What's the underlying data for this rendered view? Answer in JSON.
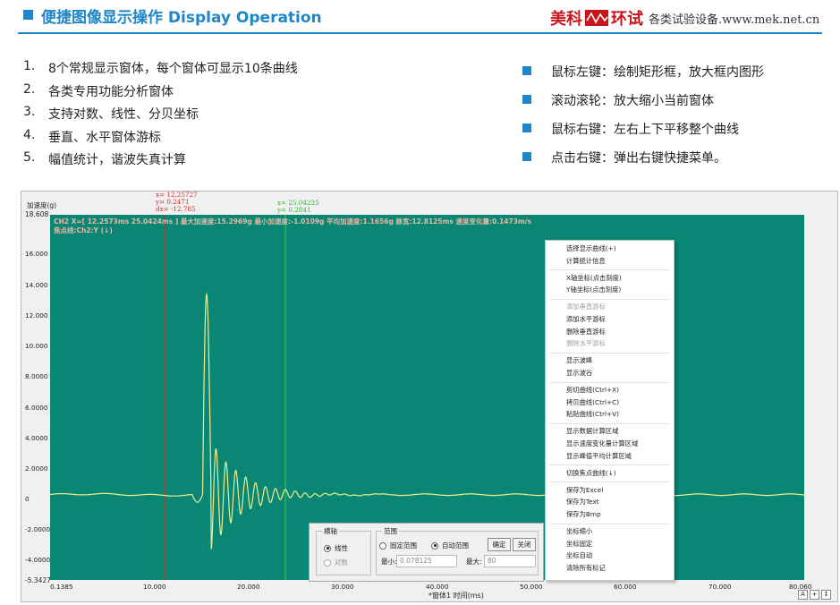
{
  "header": {
    "title": "便捷图像显示操作 Display Operation",
    "logo_brand_left": "美科",
    "logo_brand_right": "环试",
    "logo_slogan": "各类试验设备.www.mek.net.cn",
    "accent_color": "#1f86c8",
    "brand_color": "#c8151b"
  },
  "features": [
    {
      "num": "1.",
      "text": "8个常规显示窗体，每个窗体可显示10条曲线"
    },
    {
      "num": "2.",
      "text": "各类专用功能分析窗体"
    },
    {
      "num": "3.",
      "text": "支持对数、线性、分贝坐标"
    },
    {
      "num": "4.",
      "text": "垂直、水平窗体游标"
    },
    {
      "num": "5.",
      "text": "幅值统计，谐波失真计算"
    }
  ],
  "tips": [
    {
      "text": "鼠标左键：绘制矩形框，放大框内图形"
    },
    {
      "text": "滚动滚轮：放大缩小当前窗体"
    },
    {
      "text": "鼠标右键：左右上下平移整个曲线"
    },
    {
      "text": "点击右键：弹出右键快捷菜单。"
    }
  ],
  "chart": {
    "y_axis_title": "加速度(g)",
    "y_top": "18.608",
    "y_bottom": "-5.3427",
    "y_ticks": [
      "16.000",
      "14.000",
      "12.000",
      "10.000",
      "8.0000",
      "6.0000",
      "4.0000",
      "2.0000",
      "0",
      "-2.0000",
      "-4.0000"
    ],
    "x_ticks": [
      "0.1385",
      "10.000",
      "20.000",
      "30.000",
      "40.000",
      "50.000",
      "60.000",
      "70.000",
      "80.060"
    ],
    "x_axis_title": "*窗体1 时间(ms)",
    "info_line1": "CH2  X=[ 12.2573ms  25.0424ms ]  最大加速度:15.2969g  最小加速度:-1.0109g  平均加速度:1.1656g  脉宽:12.8125ms  速度变化量:0.1473m/s",
    "info_line2": "焦点线:Ch2:Y (↓)",
    "cursor1": {
      "x": "x= 12.25727",
      "y": "y= 0.2471",
      "dx": "dx= -12.785"
    },
    "cursor2": {
      "x": "x= 25.04235",
      "y": "y= 0.2841"
    },
    "plot_bg": "#0a8674",
    "curve_color": "#f0ee8c",
    "cursor1_color": "#c83030",
    "cursor2_color": "#3ad03a",
    "toolbar_buttons": [
      "A",
      "+",
      "↕"
    ]
  },
  "context_menu": [
    {
      "label": "选择显示曲线(+)",
      "enabled": true
    },
    {
      "label": "计算统计信息",
      "enabled": true,
      "sep_after": true
    },
    {
      "label": "X轴坐标(点击刻度)",
      "enabled": true
    },
    {
      "label": "Y轴坐标(点击刻度)",
      "enabled": true,
      "sep_after": true
    },
    {
      "label": "添加垂直游标",
      "enabled": false
    },
    {
      "label": "添加水平游标",
      "enabled": true
    },
    {
      "label": "删除垂直游标",
      "enabled": true
    },
    {
      "label": "删除水平游标",
      "enabled": false,
      "sep_after": true
    },
    {
      "label": "显示波峰",
      "enabled": true
    },
    {
      "label": "显示波谷",
      "enabled": true,
      "sep_after": true
    },
    {
      "label": "剪切曲线(Ctrl+X)",
      "enabled": true
    },
    {
      "label": "拷贝曲线(Ctrl+C)",
      "enabled": true
    },
    {
      "label": "粘贴曲线(Ctrl+V)",
      "enabled": true,
      "sep_after": true
    },
    {
      "label": "显示数据计算区域",
      "enabled": true
    },
    {
      "label": "显示速度变化量计算区域",
      "enabled": true
    },
    {
      "label": "显示峰值平均计算区域",
      "enabled": true,
      "sep_after": true
    },
    {
      "label": "切换焦点曲线(↓)",
      "enabled": true,
      "sep_after": true
    },
    {
      "label": "保存为Excel",
      "enabled": true
    },
    {
      "label": "保存为Text",
      "enabled": true
    },
    {
      "label": "保存为Bmp",
      "enabled": true,
      "sep_after": true
    },
    {
      "label": "坐标缩小",
      "enabled": true
    },
    {
      "label": "坐标固定",
      "enabled": true
    },
    {
      "label": "坐标自动",
      "enabled": true
    },
    {
      "label": "清除所有标记",
      "enabled": true
    }
  ],
  "axis_panel": {
    "axis_group_title": "横轴",
    "linear_label": "线性",
    "log_label": "对数",
    "linear_selected": true,
    "range_group_title": "范围",
    "fixed_range_label": "固定范围",
    "auto_range_label": "自动范围",
    "auto_selected": true,
    "ok_label": "确定",
    "close_label": "关闭",
    "min_label": "最小:",
    "min_value": "0.078125",
    "max_label": "最大:",
    "max_value": "80"
  }
}
